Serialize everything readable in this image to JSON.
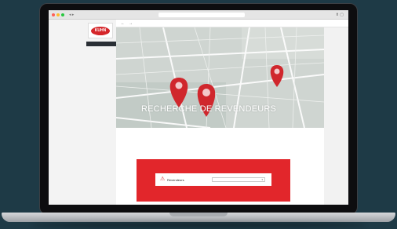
{
  "browser": {
    "url": "",
    "nav_icons": "◂ ▸",
    "right_icons": "⬆ ▢"
  },
  "sidebar": {
    "logo_text": "KUHN",
    "items": [
      {
        "label": ""
      },
      {
        "label": ""
      }
    ]
  },
  "topbar": {
    "back": "←",
    "forward": "→",
    "links": [
      "",
      "",
      ""
    ]
  },
  "hero": {
    "title": "RECHERCHE DE REVENDEURS",
    "map_colors": {
      "bg": "#cdd3d0",
      "road": "#ffffff",
      "pin": "#d0272d"
    }
  },
  "content": {
    "intro": ""
  },
  "search_panel": {
    "title": "",
    "card_label": "Revendeurs",
    "warning_icon": "⚠",
    "select_placeholder": "",
    "chevron": "▾",
    "accent": "#e2262b"
  }
}
